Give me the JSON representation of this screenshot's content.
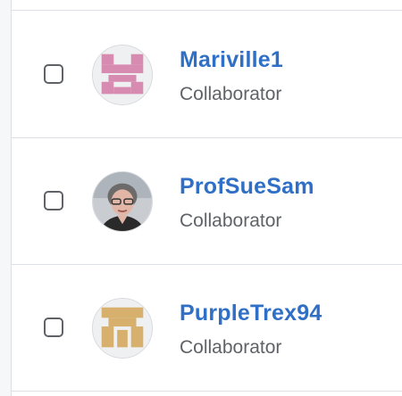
{
  "members": [
    {
      "name": "Mariville1",
      "role": "Collaborator",
      "avatar": "identicon-pink",
      "avatar_color": "#d88bb0"
    },
    {
      "name": "ProfSueSam",
      "role": "Collaborator",
      "avatar": "photo-woman-glasses"
    },
    {
      "name": "PurpleTrex94",
      "role": "Collaborator",
      "avatar": "identicon-tan",
      "avatar_color": "#d7b06d"
    }
  ],
  "colors": {
    "name_link": "#2f6fc5",
    "role_text": "#5f6368",
    "divider": "#dcdfe4"
  }
}
